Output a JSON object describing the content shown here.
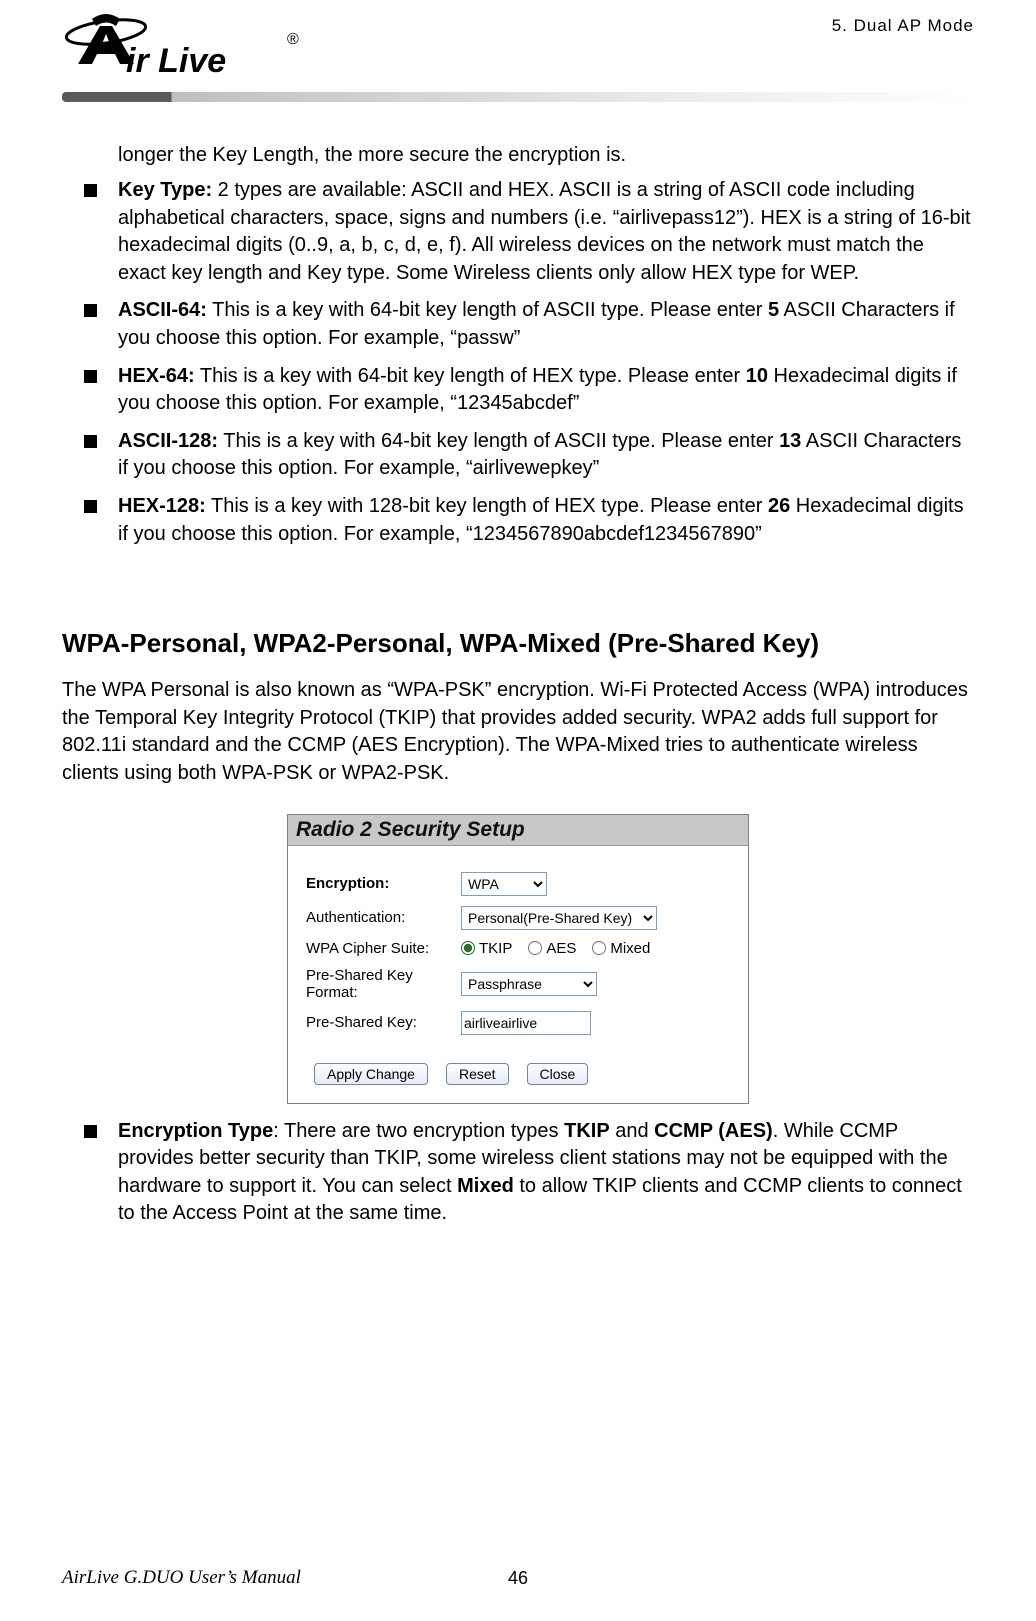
{
  "header": {
    "section": "5.   Dual  AP  Mode"
  },
  "intro_tail": "longer the Key Length, the more secure the encryption is.",
  "bullets1": [
    {
      "bold": "Key Type:",
      "text": "   2 types are available: ASCII and HEX.   ASCII is a string of ASCII code including alphabetical characters, space, signs and numbers (i.e. “airlivepass12”).   HEX is a string of 16-bit hexadecimal digits (0..9, a, b, c, d, e, f). All wireless devices on the network must match the exact key length and Key type. Some Wireless clients only allow HEX type for WEP."
    },
    {
      "bold": "ASCII-64:",
      "text_a": " This is a key with 64-bit key length of ASCII type.   Please enter ",
      "text_bold2": "5",
      "text_b": " ASCII Characters if you choose this option. For example, “passw”"
    },
    {
      "bold": "HEX-64:",
      "text_a": " This is a key with 64-bit key length of HEX type.   Please enter ",
      "text_bold2": "10",
      "text_b": " Hexadecimal digits if you choose this option. For example, “12345abcdef”"
    },
    {
      "bold": "ASCII-128:",
      "text_a": " This is a key with 64-bit key length of ASCII type.   Please enter ",
      "text_bold2": "13",
      "text_b": " ASCII Characters if you choose this option. For example, “airlivewepkey”"
    },
    {
      "bold": "HEX-128:",
      "text_a": " This is a key with 128-bit key length of HEX type.   Please enter ",
      "text_bold2": "26",
      "text_b": " Hexadecimal digits if you choose this option. For example, “1234567890abcdef1234567890”"
    }
  ],
  "section_heading": "WPA-Personal, WPA2-Personal, WPA-Mixed (Pre-Shared Key)",
  "section_para": "The WPA Personal is also known as “WPA-PSK” encryption.   Wi-Fi Protected Access (WPA) introduces the Temporal Key Integrity Protocol (TKIP) that provides added security.   WPA2 adds full support for 802.11i standard and the CCMP (AES Encryption). The WPA-Mixed tries to authenticate wireless clients using both WPA-PSK or WPA2-PSK.",
  "screenshot": {
    "title": "Radio 2 Security Setup",
    "rows": {
      "encryption_label": "Encryption:",
      "encryption_value": "WPA",
      "auth_label": "Authentication:",
      "auth_value": "Personal(Pre-Shared Key)",
      "cipher_label": "WPA Cipher Suite:",
      "cipher_tkip": "TKIP",
      "cipher_aes": "AES",
      "cipher_mixed": "Mixed",
      "pskfmt_label": "Pre-Shared Key Format:",
      "pskfmt_value": "Passphrase",
      "psk_label": "Pre-Shared Key:",
      "psk_value": "airliveairlive"
    },
    "buttons": {
      "apply": "Apply Change",
      "reset": "Reset",
      "close": "Close"
    }
  },
  "bullets2": [
    {
      "bold": "Encryption Type",
      "colon": ":",
      "text_a": "   There are two encryption types ",
      "bold2": "TKIP",
      "mid": " and ",
      "bold3": "CCMP (AES)",
      "text_b": ". While CCMP provides better security than TKIP, some wireless client stations may not be equipped with the hardware to support it. You can select ",
      "bold4": "Mixed",
      "text_c": " to allow TKIP clients and CCMP clients to connect to the Access Point at the same time."
    }
  ],
  "footer": {
    "left": "AirLive G.DUO User’s Manual",
    "center": "46"
  }
}
